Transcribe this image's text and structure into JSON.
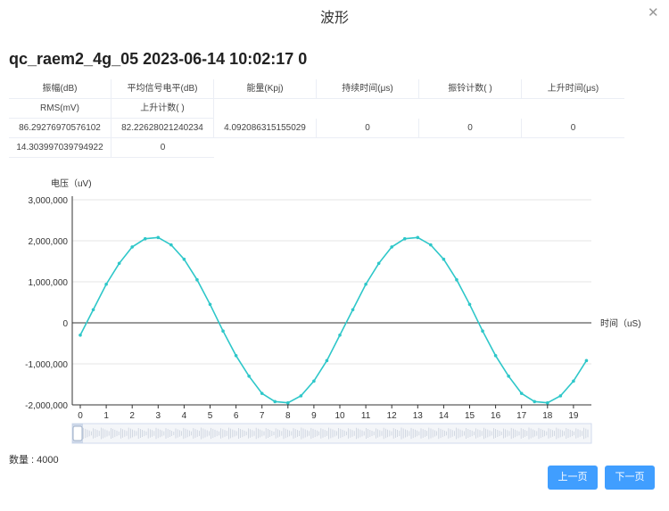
{
  "modal": {
    "title": "波形",
    "close_icon": "close-icon"
  },
  "record_title": "qc_raem2_4g_05 2023-06-14 10:02:17 0",
  "table": {
    "headers_row1": [
      "振幅(dB)",
      "平均信号电平(dB)",
      "能量(Kpj)",
      "持续时间(μs)",
      "振铃计数( )",
      "上升时间(μs)"
    ],
    "headers_row2": [
      "RMS(mV)",
      "上升计数( )"
    ],
    "values_row1": [
      "86.29276970576102",
      "82.22628021240234",
      "4.092086315155029",
      "0",
      "0",
      "0"
    ],
    "values_row2": [
      "14.303997039794922",
      "0"
    ]
  },
  "chart_data": {
    "type": "line",
    "ylabel": "电压（uV)",
    "xlabel": "时间（uS)",
    "ylim": [
      -2000000,
      3000000
    ],
    "yticks": [
      -2000000,
      -1000000,
      0,
      1000000,
      2000000,
      3000000
    ],
    "ytick_labels": [
      "-2,000,000",
      "-1,000,000",
      "0",
      "1,000,000",
      "2,000,000",
      "3,000,000"
    ],
    "xlim": [
      0,
      19.5
    ],
    "xticks": [
      0,
      1,
      2,
      3,
      4,
      5,
      6,
      7,
      8,
      9,
      10,
      11,
      12,
      13,
      14,
      15,
      16,
      17,
      18,
      19
    ],
    "xtick_labels": [
      "0",
      "1",
      "2",
      "3",
      "4",
      "5",
      "6",
      "7",
      "8",
      "9",
      "10",
      "11",
      "12",
      "13",
      "14",
      "15",
      "16",
      "17",
      "18",
      "19"
    ],
    "grid": true,
    "color": "#2ec7c9",
    "series": [
      {
        "x": [
          0,
          0.5,
          1,
          1.5,
          2,
          2.5,
          3,
          3.5,
          4,
          4.5,
          5,
          5.5,
          6,
          6.5,
          7,
          7.5,
          8,
          8.5,
          9,
          9.5,
          10,
          10.5,
          11,
          11.5,
          12,
          12.5,
          13,
          13.5,
          14,
          14.5,
          15,
          15.5,
          16,
          16.5,
          17,
          17.5,
          18,
          18.5,
          19,
          19.5
        ],
        "values": [
          -300000,
          320000,
          940000,
          1450000,
          1850000,
          2050000,
          2080000,
          1900000,
          1550000,
          1050000,
          450000,
          -200000,
          -800000,
          -1300000,
          -1720000,
          -1920000,
          -1950000,
          -1780000,
          -1420000,
          -920000,
          -300000,
          320000,
          940000,
          1450000,
          1850000,
          2050000,
          2080000,
          1900000,
          1550000,
          1050000,
          450000,
          -200000,
          -800000,
          -1300000,
          -1720000,
          -1920000,
          -1950000,
          -1780000,
          -1420000,
          -920000
        ]
      }
    ]
  },
  "count_label": "数量 : 4000",
  "buttons": {
    "prev": "上一页",
    "next": "下一页"
  }
}
